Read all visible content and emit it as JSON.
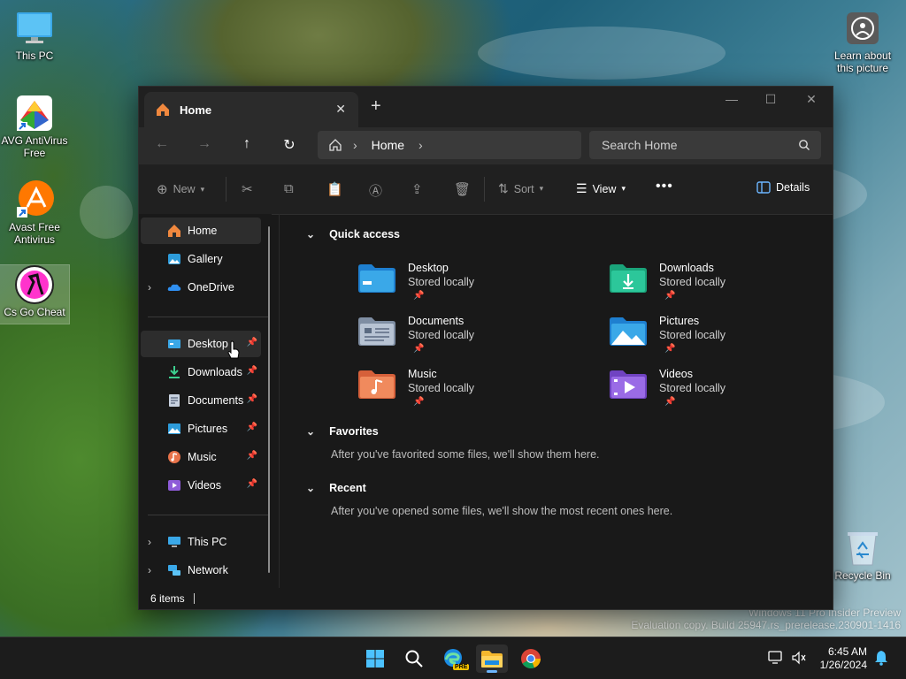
{
  "desktop": {
    "icons": [
      {
        "label": "This PC"
      },
      {
        "label": "AVG AntiVirus Free"
      },
      {
        "label": "Avast Free Antivirus"
      },
      {
        "label": "Cs Go Cheat"
      },
      {
        "label": "Learn about this picture"
      },
      {
        "label": "Recycle Bin"
      }
    ],
    "watermark": {
      "line1": "Windows 11 Pro Insider Preview",
      "line2": "Evaluation copy. Build 25947.rs_prerelease.230901-1416"
    }
  },
  "explorer": {
    "tab_title": "Home",
    "address": {
      "crumb": "Home"
    },
    "search_placeholder": "Search Home",
    "commands": {
      "new": "New",
      "sort": "Sort",
      "view": "View",
      "more": "•••",
      "details": "Details"
    },
    "nav": {
      "top": [
        "Home",
        "Gallery",
        "OneDrive"
      ],
      "pinned": [
        "Desktop",
        "Downloads",
        "Documents",
        "Pictures",
        "Music",
        "Videos"
      ],
      "bottom": [
        "This PC",
        "Network"
      ]
    },
    "sections": {
      "quick_access": "Quick access",
      "favorites": "Favorites",
      "favorites_note": "After you've favorited some files, we'll show them here.",
      "recent": "Recent",
      "recent_note": "After you've opened some files, we'll show the most recent ones here."
    },
    "quick_access": [
      {
        "name": "Desktop",
        "sub": "Stored locally"
      },
      {
        "name": "Downloads",
        "sub": "Stored locally"
      },
      {
        "name": "Documents",
        "sub": "Stored locally"
      },
      {
        "name": "Pictures",
        "sub": "Stored locally"
      },
      {
        "name": "Music",
        "sub": "Stored locally"
      },
      {
        "name": "Videos",
        "sub": "Stored locally"
      }
    ],
    "status": "6 items"
  },
  "taskbar": {
    "time": "6:45 AM",
    "date": "1/26/2024",
    "edge_badge": "PRE"
  },
  "colors": {
    "window_bg": "#191919",
    "accent": "#6cb6ff"
  }
}
